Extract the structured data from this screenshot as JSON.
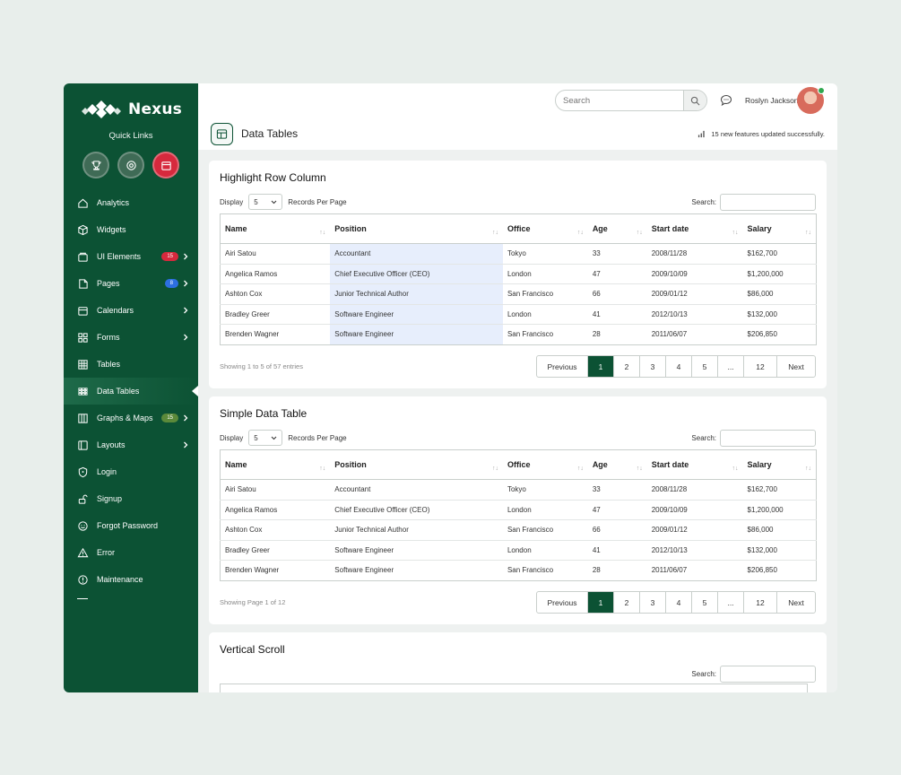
{
  "brand": {
    "name": "Nexus",
    "quick_links": "Quick Links"
  },
  "quick_icons": [
    "trophy-icon",
    "target-icon",
    "calendar-icon"
  ],
  "nav": [
    {
      "label": "Analytics",
      "icon": "home-icon"
    },
    {
      "label": "Widgets",
      "icon": "cube-icon"
    },
    {
      "label": "UI Elements",
      "icon": "box-icon",
      "badge": "15",
      "badge_color": "#d6293d",
      "chevron": true
    },
    {
      "label": "Pages",
      "icon": "pages-icon",
      "badge": "8",
      "badge_color": "#2d6fe0",
      "chevron": true
    },
    {
      "label": "Calendars",
      "icon": "calendar-icon",
      "chevron": true
    },
    {
      "label": "Forms",
      "icon": "grid-icon",
      "chevron": true
    },
    {
      "label": "Tables",
      "icon": "table-icon"
    },
    {
      "label": "Data Tables",
      "icon": "data-table-icon",
      "active": true
    },
    {
      "label": "Graphs & Maps",
      "icon": "columns-icon",
      "badge": "15",
      "badge_color": "#5b8a3a",
      "chevron": true
    },
    {
      "label": "Layouts",
      "icon": "layout-icon",
      "chevron": true
    },
    {
      "label": "Login",
      "icon": "shield-icon"
    },
    {
      "label": "Signup",
      "icon": "unlock-icon"
    },
    {
      "label": "Forgot Password",
      "icon": "smile-icon"
    },
    {
      "label": "Error",
      "icon": "warning-icon"
    },
    {
      "label": "Maintenance",
      "icon": "info-icon"
    }
  ],
  "topbar": {
    "search_placeholder": "Search",
    "user_name": "Roslyn Jackson"
  },
  "page": {
    "title": "Data Tables",
    "notice": "15 new features updated successfully."
  },
  "table_common": {
    "display_label": "Display",
    "display_value": "5",
    "records_label": "Records Per Page",
    "search_label": "Search:",
    "columns": [
      "Name",
      "Position",
      "Office",
      "Age",
      "Start date",
      "Salary"
    ],
    "rows": [
      [
        "Airi Satou",
        "Accountant",
        "Tokyo",
        "33",
        "2008/11/28",
        "$162,700"
      ],
      [
        "Angelica Ramos",
        "Chief Executive Officer (CEO)",
        "London",
        "47",
        "2009/10/09",
        "$1,200,000"
      ],
      [
        "Ashton Cox",
        "Junior Technical Author",
        "San Francisco",
        "66",
        "2009/01/12",
        "$86,000"
      ],
      [
        "Bradley Greer",
        "Software Engineer",
        "London",
        "41",
        "2012/10/13",
        "$132,000"
      ],
      [
        "Brenden Wagner",
        "Software Engineer",
        "San Francisco",
        "28",
        "2011/06/07",
        "$206,850"
      ]
    ],
    "pagination": [
      "Previous",
      "1",
      "2",
      "3",
      "4",
      "5",
      "...",
      "12",
      "Next"
    ]
  },
  "card1": {
    "title": "Highlight Row Column",
    "showing": "Showing 1 to 5 of 57 entries"
  },
  "card2": {
    "title": "Simple Data Table",
    "showing": "Showing Page 1 of 12"
  },
  "card3": {
    "title": "Vertical Scroll"
  },
  "colors": {
    "brand_green": "#0c5234",
    "highlight": "#e7eefc",
    "badge_red": "#d6293d"
  }
}
